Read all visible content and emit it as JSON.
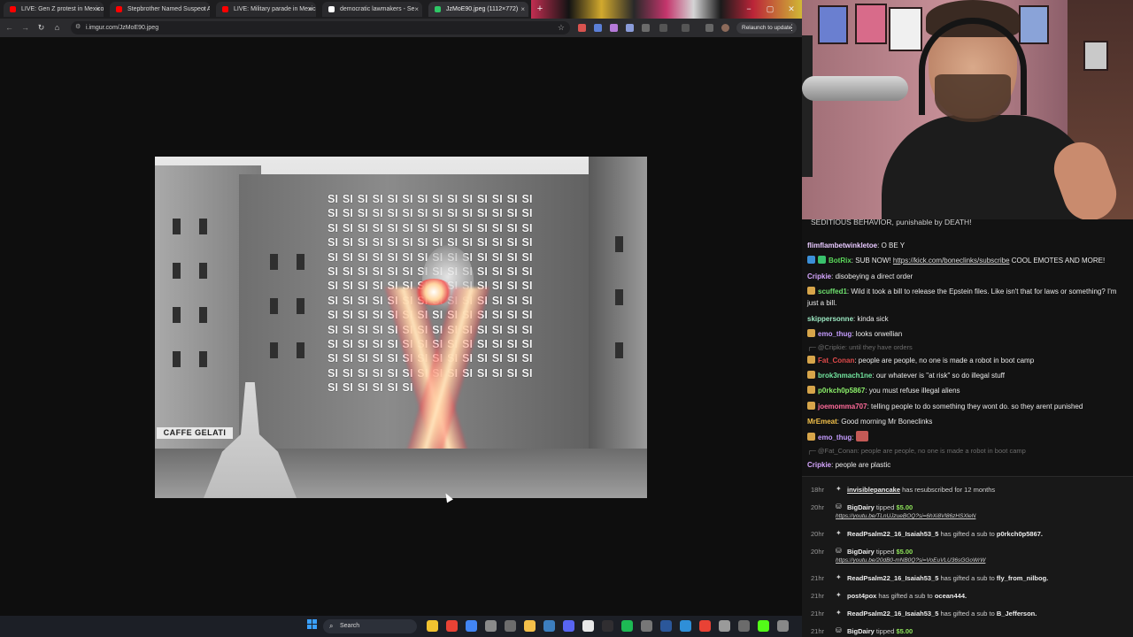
{
  "browser": {
    "tabs": [
      {
        "label": "LIVE: Gen Z protest in Mexico",
        "favicon_color": "#ff0000",
        "active": false
      },
      {
        "label": "Stepbrother Named Suspect At",
        "favicon_color": "#ff0000",
        "active": false
      },
      {
        "label": "LIVE: Military parade in Mexico",
        "favicon_color": "#ff0000",
        "active": false
      },
      {
        "label": "democratic lawmakers - Se",
        "favicon_color": "#ffffff",
        "active": false
      },
      {
        "label": "JzMoE90.jpeg (1112×772)",
        "favicon_color": "#2ec866",
        "active": true
      }
    ],
    "new_tab_symbol": "+",
    "window_controls": {
      "minimize": "−",
      "maximize": "▢",
      "close": "✕"
    },
    "url": "i.imgur.com/JzMoE90.jpeg",
    "relaunch_label": "Relaunch to update",
    "nav_icons": [
      "back-icon",
      "forward-icon",
      "reload-icon",
      "home-icon"
    ]
  },
  "image": {
    "si_text": "SI SI SI SI SI SI SI SI SI SI SI SI SI SI SI SI SI SI SI SI SI SI SI SI SI SI SI SI SI SI SI SI SI SI SI SI SI SI SI SI SI SI SI SI SI SI SI SI SI SI SI SI SI SI SI SI SI SI SI SI SI SI SI SI SI SI SI SI SI SI SI SI SI SI SI SI SI SI SI SI SI SI SI SI SI SI SI SI SI SI SI SI SI SI SI SI SI SI SI SI SI SI SI SI SI SI SI SI SI SI SI SI SI SI SI SI SI SI SI SI SI SI SI SI SI SI SI SI SI SI SI SI SI SI SI SI SI SI SI SI SI SI SI SI SI SI SI SI SI SI SI SI SI SI SI SI SI SI SI SI SI SI SI SI SI SI SI SI SI SI SI SI SI SI SI SI SI SI SI SI SI SI SI SI SI SI SI SI",
    "shop_sign": "CAFFE  GELATI"
  },
  "taskbar": {
    "search_placeholder": "Search",
    "start_color": "#3aa0ff",
    "pinned_icons": [
      {
        "name": "file-explorer-icon",
        "color": "#f2c230"
      },
      {
        "name": "chrome-icon",
        "color": "#e94235"
      },
      {
        "name": "chrome-icon-2",
        "color": "#4285f4"
      },
      {
        "name": "app-icon",
        "color": "#8a8a8a"
      },
      {
        "name": "gamepad-icon",
        "color": "#6d6d6d"
      },
      {
        "name": "folder-icon",
        "color": "#f4c04a"
      },
      {
        "name": "steam-icon",
        "color": "#3c7ebf"
      },
      {
        "name": "discord-icon",
        "color": "#5865f2"
      },
      {
        "name": "capcut-icon",
        "color": "#e8e8e8"
      },
      {
        "name": "obs-icon",
        "color": "#302e31"
      },
      {
        "name": "spotify-icon",
        "color": "#1db954"
      },
      {
        "name": "app-icon-2",
        "color": "#777777"
      },
      {
        "name": "word-icon",
        "color": "#2b579a"
      },
      {
        "name": "edge-icon",
        "color": "#2f8fd8"
      },
      {
        "name": "maps-icon",
        "color": "#e94235"
      },
      {
        "name": "tool-icon",
        "color": "#9a9a9a"
      },
      {
        "name": "screen-icon",
        "color": "#6b6b6b"
      },
      {
        "name": "kick-icon",
        "color": "#53fc18"
      },
      {
        "name": "settings-icon",
        "color": "#888888"
      }
    ]
  },
  "chat": {
    "header": "SEDITIOUS BEHAVIOR, punishable by DEATH!",
    "messages": [
      {
        "user": "flimflambetwinkletoe",
        "user_color": "#e8c9ff",
        "text": "O BE Y",
        "badges": []
      },
      {
        "user": "BotRix",
        "user_color": "#5bd95b",
        "text_before": "SUB NOW! ",
        "link": "https://kick.com/boneclinks/subscribe",
        "text": " COOL EMOTES AND MORE!",
        "badges": [
          "#3b8fd8",
          "#39c16c"
        ]
      },
      {
        "user": "Cripkie",
        "user_color": "#d6a6ff",
        "text": "disobeying a direct order",
        "badges": []
      },
      {
        "user": "scuffed1",
        "user_color": "#6ee06e",
        "text": "Wild it took a bill to release the Epstein files. Like isn't that for laws or something? I'm just a bill.",
        "badges": [
          "#d7a54a"
        ]
      },
      {
        "user": "skippersonne",
        "user_color": "#9be8c2",
        "text": "kinda sick",
        "badges": []
      },
      {
        "user": "emo_thug",
        "user_color": "#c49cff",
        "text": "looks orwellian",
        "badges": [
          "#d7a54a"
        ]
      },
      {
        "reply_to": "@Cripkie:",
        "reply_text": "until they have orders"
      },
      {
        "user": "Fat_Conan",
        "user_color": "#e04a4a",
        "text": "people are people, no one is made a robot in boot camp",
        "badges": [
          "#d7a54a"
        ]
      },
      {
        "user": "brok3nmach1ne",
        "user_color": "#73e6a0",
        "text": "our whatever is \"at risk\" so do illegal stuff",
        "badges": [
          "#d7a54a"
        ]
      },
      {
        "user": "p0rkch0p5867",
        "user_color": "#8cf06a",
        "text": "you must refuse illegal aliens",
        "badges": [
          "#d7a54a"
        ]
      },
      {
        "user": "joemomma707",
        "user_color": "#ff6a9a",
        "text": "telling people to do something they wont do. so they arent punished",
        "badges": [
          "#d7a54a"
        ]
      },
      {
        "user": "MrEmeat",
        "user_color": "#f2c04a",
        "text": "Good morning Mr Boneclinks",
        "badges": []
      },
      {
        "user": "emo_thug",
        "user_color": "#c49cff",
        "text": "",
        "emote": "face-emote",
        "badges": [
          "#d7a54a"
        ]
      },
      {
        "reply_to": "@Fat_Conan:",
        "reply_text": "people are people, no one is made a robot in boot camp"
      },
      {
        "user": "Cripkie",
        "user_color": "#d6a6ff",
        "text": "people are plastic",
        "badges": []
      }
    ]
  },
  "events": [
    {
      "time": "18hr",
      "user": "invisiblepancake",
      "text": " has resubscribed for 12 months",
      "underline": true
    },
    {
      "time": "20hr",
      "user": "BigDairy",
      "text": " tipped ",
      "amount": "$5.00",
      "link": "https://youtu.be/TLnUJzueBOQ?si=6hXi8Vl86zHSXleN"
    },
    {
      "time": "20hr",
      "user": "ReadPsalm22_16_Isaiah53_5",
      "text": " has gifted a sub to ",
      "target": "p0rkch0p5867."
    },
    {
      "time": "20hr",
      "user": "BigDairy",
      "text": " tipped ",
      "amount": "$5.00",
      "link": "https://youtu.be/20dB0-mNB0Q?si=VoEuVLU36sGGoWrW"
    },
    {
      "time": "21hr",
      "user": "ReadPsalm22_16_Isaiah53_5",
      "text": " has gifted a sub to ",
      "target": "fly_from_nilbog."
    },
    {
      "time": "21hr",
      "user": "post4pox",
      "text": " has gifted a sub to ",
      "target": "ocean444."
    },
    {
      "time": "21hr",
      "user": "ReadPsalm22_16_Isaiah53_5",
      "text": " has gifted a sub to ",
      "target": "B_Jefferson."
    },
    {
      "time": "21hr",
      "user": "BigDairy",
      "text": " tipped ",
      "amount": "$5.00"
    }
  ]
}
